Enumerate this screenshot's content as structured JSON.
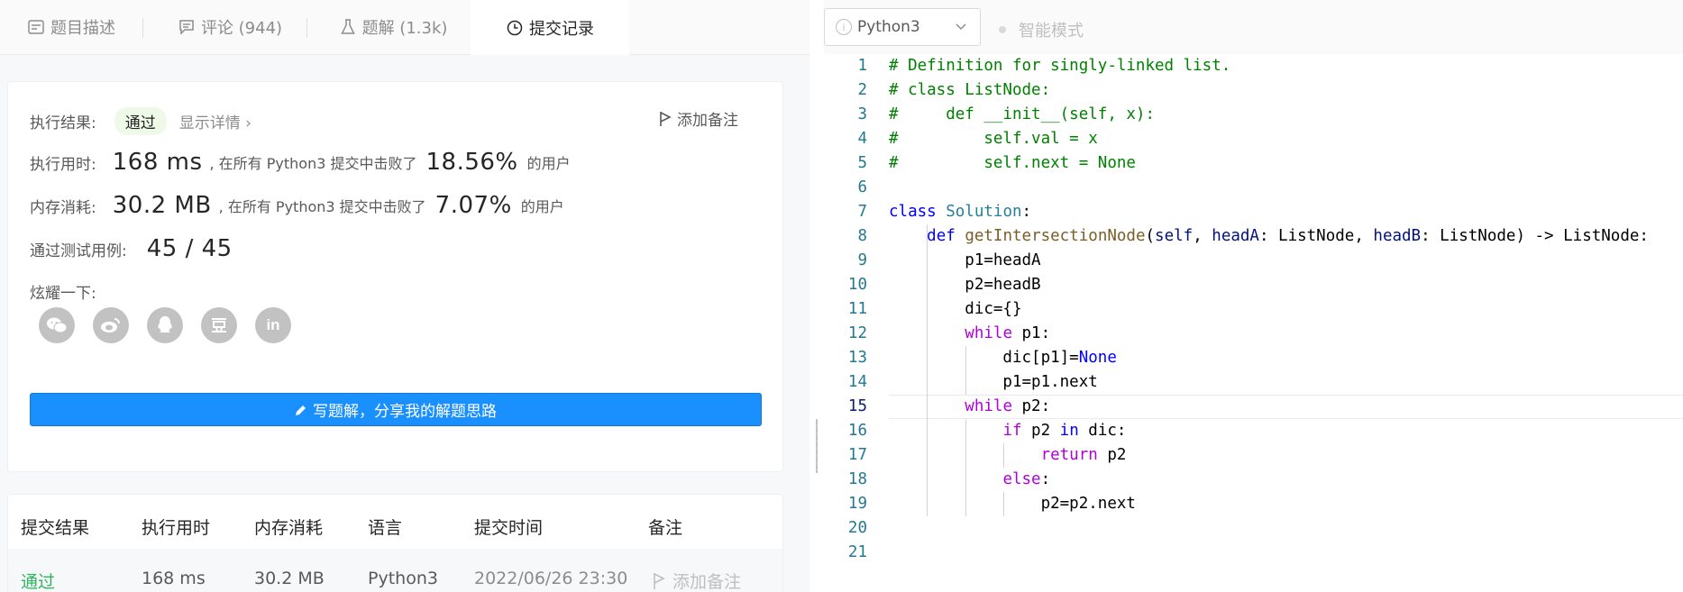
{
  "tabs": [
    {
      "label": "题目描述",
      "icon": "description-icon"
    },
    {
      "label": "评论 (944)",
      "icon": "comment-icon"
    },
    {
      "label": "题解 (1.3k)",
      "icon": "flask-icon"
    },
    {
      "label": "提交记录",
      "icon": "clock-icon"
    }
  ],
  "result": {
    "exec_label": "执行结果:",
    "status": "通过",
    "show_detail": "显示详情",
    "add_note": "添加备注",
    "time_label": "执行用时:",
    "time_value": "168 ms",
    "time_mid": ", 在所有 Python3 提交中击败了",
    "time_pct": "18.56%",
    "users": "的用户",
    "mem_label": "内存消耗:",
    "mem_value": "30.2 MB",
    "mem_mid": ", 在所有 Python3 提交中击败了",
    "mem_pct": "7.07%",
    "tests_label": "通过测试用例:",
    "tests_value": "45 / 45",
    "share_label": "炫耀一下:",
    "share_icons": [
      "wechat-icon",
      "weibo-icon",
      "qq-icon",
      "douban-icon",
      "linkedin-icon"
    ],
    "write_solution": "写题解，分享我的解题思路"
  },
  "table": {
    "headers": [
      "提交结果",
      "执行用时",
      "内存消耗",
      "语言",
      "提交时间",
      "备注"
    ],
    "rows": [
      {
        "status": "通过",
        "time": "168 ms",
        "memory": "30.2 MB",
        "language": "Python3",
        "submitted": "2022/06/26 23:30",
        "note": "添加备注"
      }
    ]
  },
  "editor": {
    "language": "Python3",
    "smart_mode": "智能模式",
    "current_line": 15,
    "lines": [
      "# Definition for singly-linked list.",
      "# class ListNode:",
      "#     def __init__(self, x):",
      "#         self.val = x",
      "#         self.next = None",
      "",
      "class Solution:",
      "    def getIntersectionNode(self, headA: ListNode, headB: ListNode) -> ListNode:",
      "        p1=headA",
      "        p2=headB",
      "        dic={}",
      "        while p1:",
      "            dic[p1]=None",
      "            p1=p1.next",
      "        while p2:",
      "            if p2 in dic:",
      "                return p2",
      "            else:",
      "                p2=p2.next",
      "",
      ""
    ]
  },
  "colors": {
    "accent": "#1a90ff",
    "success": "#2db55d",
    "comment": "#008000",
    "keyword": "#0000ff",
    "control": "#af00db"
  }
}
